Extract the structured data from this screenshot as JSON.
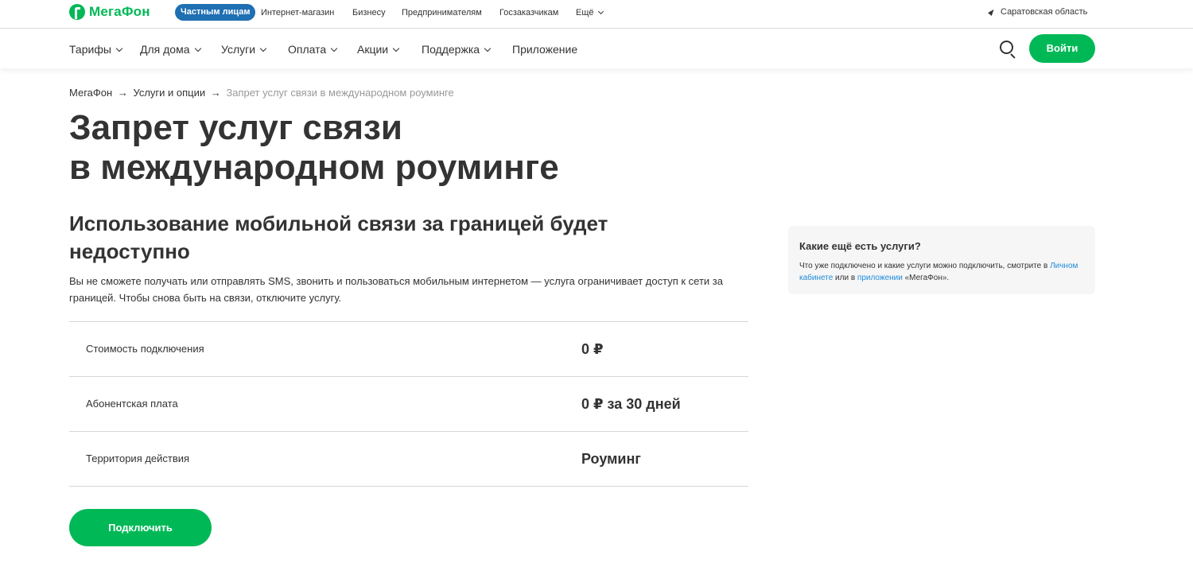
{
  "brand": {
    "name": "МегаФон",
    "accent": "#00b956",
    "segment_color": "#1f6fb3",
    "link_color": "#1f8bdc"
  },
  "topbar": {
    "segment": "Частным лицам",
    "links": [
      "Интернет-магазин",
      "Бизнесу",
      "Предпринимателям",
      "Госзаказчикам",
      "Ещё"
    ],
    "region": "Саратовская область"
  },
  "nav": {
    "items": [
      "Тарифы",
      "Для дома",
      "Услуги",
      "Оплата",
      "Акции",
      "Поддержка",
      "Приложение"
    ],
    "login": "Войти",
    "search_icon": "search-icon"
  },
  "breadcrumb": {
    "items": [
      "МегаФон",
      "Услуги и опции"
    ],
    "current": "Запрет услуг связи в международном роуминге",
    "separator": "→"
  },
  "page": {
    "title_line1": "Запрет услуг связи",
    "title_line2": "в международном роуминге",
    "subtitle": "Использование мобильной связи за границей будет недоступно",
    "description": "Вы не сможете получать или отправлять SMS, звонить и пользоваться мобильным интернетом — услуга ограничивает доступ к сети за границей. Чтобы снова быть на связи, отключите услугу."
  },
  "params": [
    {
      "label": "Стоимость подключения",
      "value": "0 ₽"
    },
    {
      "label": "Абонентская плата",
      "value": "0 ₽ за 30 дней"
    },
    {
      "label": "Территория действия",
      "value": "Роуминг"
    }
  ],
  "actions": {
    "connect": "Подключить"
  },
  "side_card": {
    "title": "Какие ещё есть услуги?",
    "text_part1": "Что уже подключено и какие услуги можно подключить, смотрите в ",
    "link1": "Личном кабинете",
    "text_part2": " или в ",
    "link2": "приложении",
    "text_part3": " «МегаФон»."
  }
}
